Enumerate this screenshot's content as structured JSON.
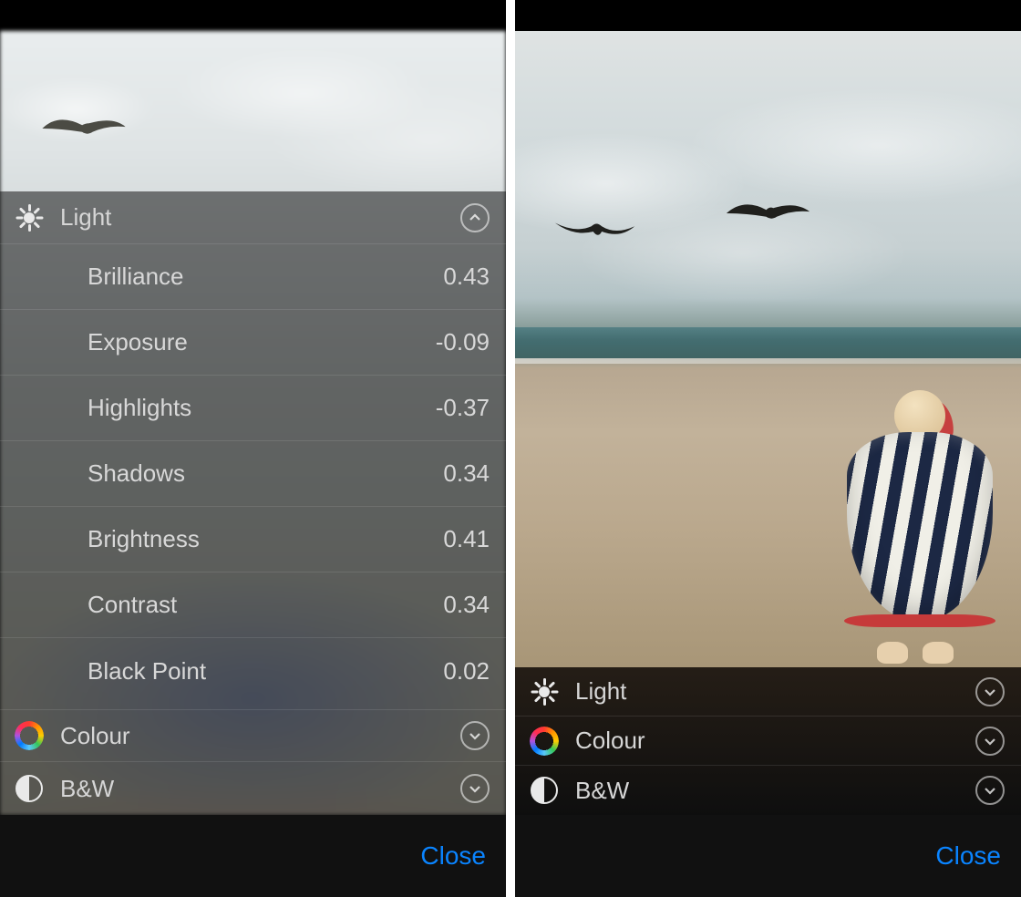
{
  "colors": {
    "accent": "#0a84ff"
  },
  "close_label": "Close",
  "left": {
    "sections": {
      "light": {
        "label": "Light",
        "expanded": true
      },
      "colour": {
        "label": "Colour",
        "expanded": false
      },
      "bw": {
        "label": "B&W",
        "expanded": false
      }
    },
    "light_params": [
      {
        "label": "Brilliance",
        "value": "0.43"
      },
      {
        "label": "Exposure",
        "value": "-0.09"
      },
      {
        "label": "Highlights",
        "value": "-0.37"
      },
      {
        "label": "Shadows",
        "value": "0.34"
      },
      {
        "label": "Brightness",
        "value": "0.41"
      },
      {
        "label": "Contrast",
        "value": "0.34"
      },
      {
        "label": "Black Point",
        "value": "0.02"
      }
    ]
  },
  "right": {
    "sections": {
      "light": {
        "label": "Light",
        "expanded": false
      },
      "colour": {
        "label": "Colour",
        "expanded": false
      },
      "bw": {
        "label": "B&W",
        "expanded": false
      }
    }
  }
}
